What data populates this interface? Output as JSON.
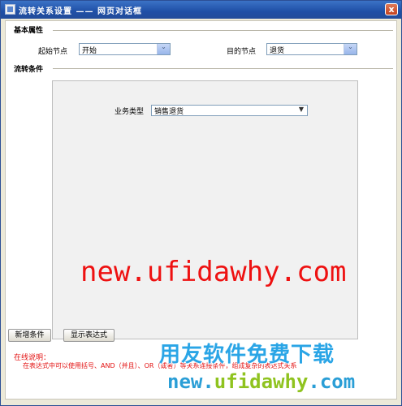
{
  "window": {
    "title": "流转关系设置 —— 网页对话框",
    "close_label": "x"
  },
  "basic": {
    "title": "基本属性",
    "start_label": "起始节点",
    "start_value": "开始",
    "target_label": "目的节点",
    "target_value": "退货"
  },
  "conditions": {
    "title": "流转条件",
    "biz_label": "业务类型",
    "biz_value": "销售退货"
  },
  "watermark": "new.ufidawhy.com",
  "buttons": {
    "add_condition": "新增条件",
    "show_expression": "显示表达式"
  },
  "notes": {
    "line1": "在线说明：",
    "line2": "在表达式中可以使用括号、AND（并且）、OR（或者）等关系连接条件，组成复杂的表达式关系"
  },
  "brand": {
    "cn": "用友软件免费下载",
    "url_pre": "new.",
    "url_mid": "ufidawhy",
    "url_post": ".com"
  }
}
